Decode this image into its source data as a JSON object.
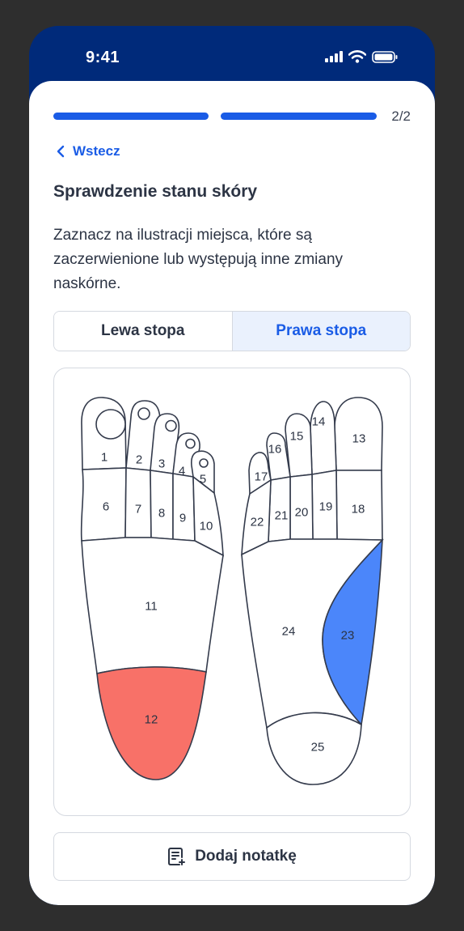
{
  "status_bar": {
    "time": "9:41"
  },
  "progress": {
    "step_label": "2/2",
    "value": 1.0
  },
  "nav": {
    "back_label": "Wstecz"
  },
  "title": "Sprawdzenie stanu skóry",
  "description": "Zaznacz na ilustracji miejsca, które są zaczerwienione lub występują inne zmiany naskórne.",
  "tabs": [
    {
      "label": "Lewa stopa",
      "selected": false
    },
    {
      "label": "Prawa stopa",
      "selected": true
    }
  ],
  "zones": {
    "z1": "1",
    "z2": "2",
    "z3": "3",
    "z4": "4",
    "z5": "5",
    "z6": "6",
    "z7": "7",
    "z8": "8",
    "z9": "9",
    "z10": "10",
    "z11": "11",
    "z12": "12",
    "z13": "13",
    "z14": "14",
    "z15": "15",
    "z16": "16",
    "z17": "17",
    "z18": "18",
    "z19": "19",
    "z20": "20",
    "z21": "21",
    "z22": "22",
    "z23": "23",
    "z24": "24",
    "z25": "25"
  },
  "selected_zones": {
    "12": "#f87168",
    "23": "#4b86fa"
  },
  "note_button": {
    "label": "Dodaj notatkę",
    "icon": "note-add-icon"
  }
}
